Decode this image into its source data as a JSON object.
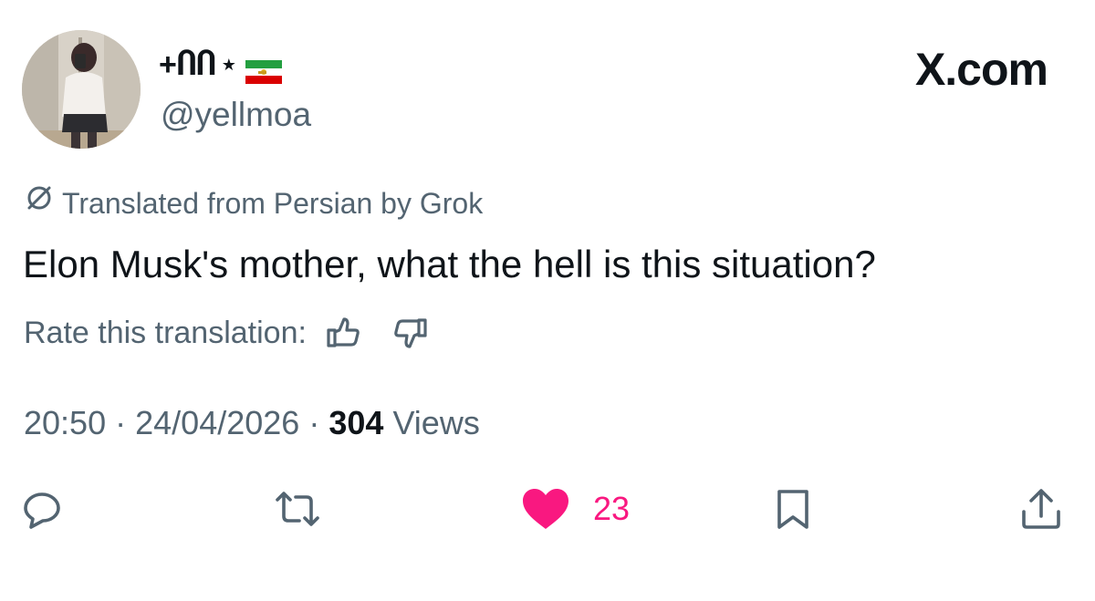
{
  "author": {
    "display_name_glyphs": "+ႶႶ",
    "display_name_star": "★",
    "handle": "@yellmoa",
    "flag_icon": "iran-lion-and-sun-flag-icon"
  },
  "brand": "X.com",
  "translation": {
    "notice": "Translated from Persian by Grok",
    "rate_label": "Rate this translation:"
  },
  "tweet": {
    "text": "Elon Musk's mother, what the hell is this situation?",
    "time": "20:50",
    "date": "24/04/2026",
    "separator": "·",
    "views_count": "304",
    "views_label": "Views"
  },
  "actions": {
    "like_count": "23"
  },
  "colors": {
    "text": "#0f1419",
    "secondary": "#536471",
    "like": "#f91880"
  }
}
